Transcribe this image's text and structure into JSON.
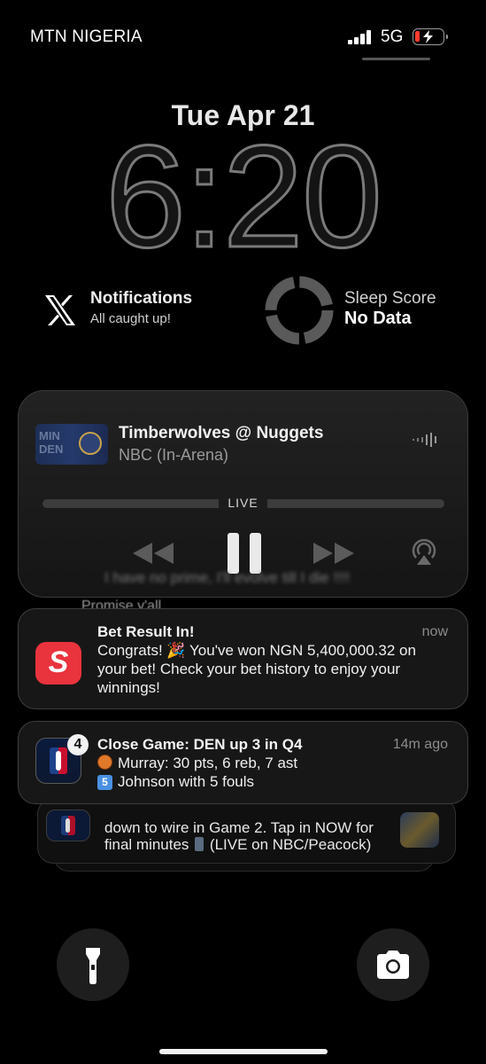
{
  "status_bar": {
    "carrier": "MTN NIGERIA",
    "network": "5G",
    "battery_color": "#ff3b30"
  },
  "lock_screen": {
    "date": "Tue Apr 21",
    "time": "6:20"
  },
  "widgets": {
    "notifications": {
      "icon": "x-logo-icon",
      "title": "Notifications",
      "subtitle": "All caught up!"
    },
    "sleep": {
      "icon": "sleep-ring-icon",
      "title": "Sleep Score",
      "value": "No Data"
    }
  },
  "now_playing": {
    "title": "Timberwolves @ Nuggets",
    "source": "NBC (In-Arena)",
    "status": "LIVE",
    "artwork_text": "MIN DEN",
    "controls": [
      "rewind-icon",
      "pause-icon",
      "fast-forward-icon",
      "airplay-icon"
    ]
  },
  "background_fragments": {
    "line1": "I have no prime, I'll evolve till I die !!!!",
    "line2": "Promise y'all"
  },
  "notifications": [
    {
      "app_icon": "sportybet-icon",
      "title": "Bet Result In!",
      "time": "now",
      "body": "Congrats! 🎉 You've won NGN 5,400,000.32 on your bet! Check your bet history to enjoy your winnings!"
    },
    {
      "app_icon": "nba-icon",
      "badge": "4",
      "title": "Close Game: DEN up 3 in Q4",
      "time": "14m ago",
      "line1": "Murray: 30 pts, 6 reb, 7 ast",
      "line2": "Johnson with 5 fouls",
      "line2_prefix": "5"
    },
    {
      "app_icon": "nba-icon",
      "line1": "down to wire in Game 2. Tap in NOW for",
      "line2_a": "final minutes",
      "line2_b": "(LIVE on NBC/Peacock)"
    }
  ],
  "bottom_controls": [
    "flashlight-icon",
    "camera-icon"
  ]
}
